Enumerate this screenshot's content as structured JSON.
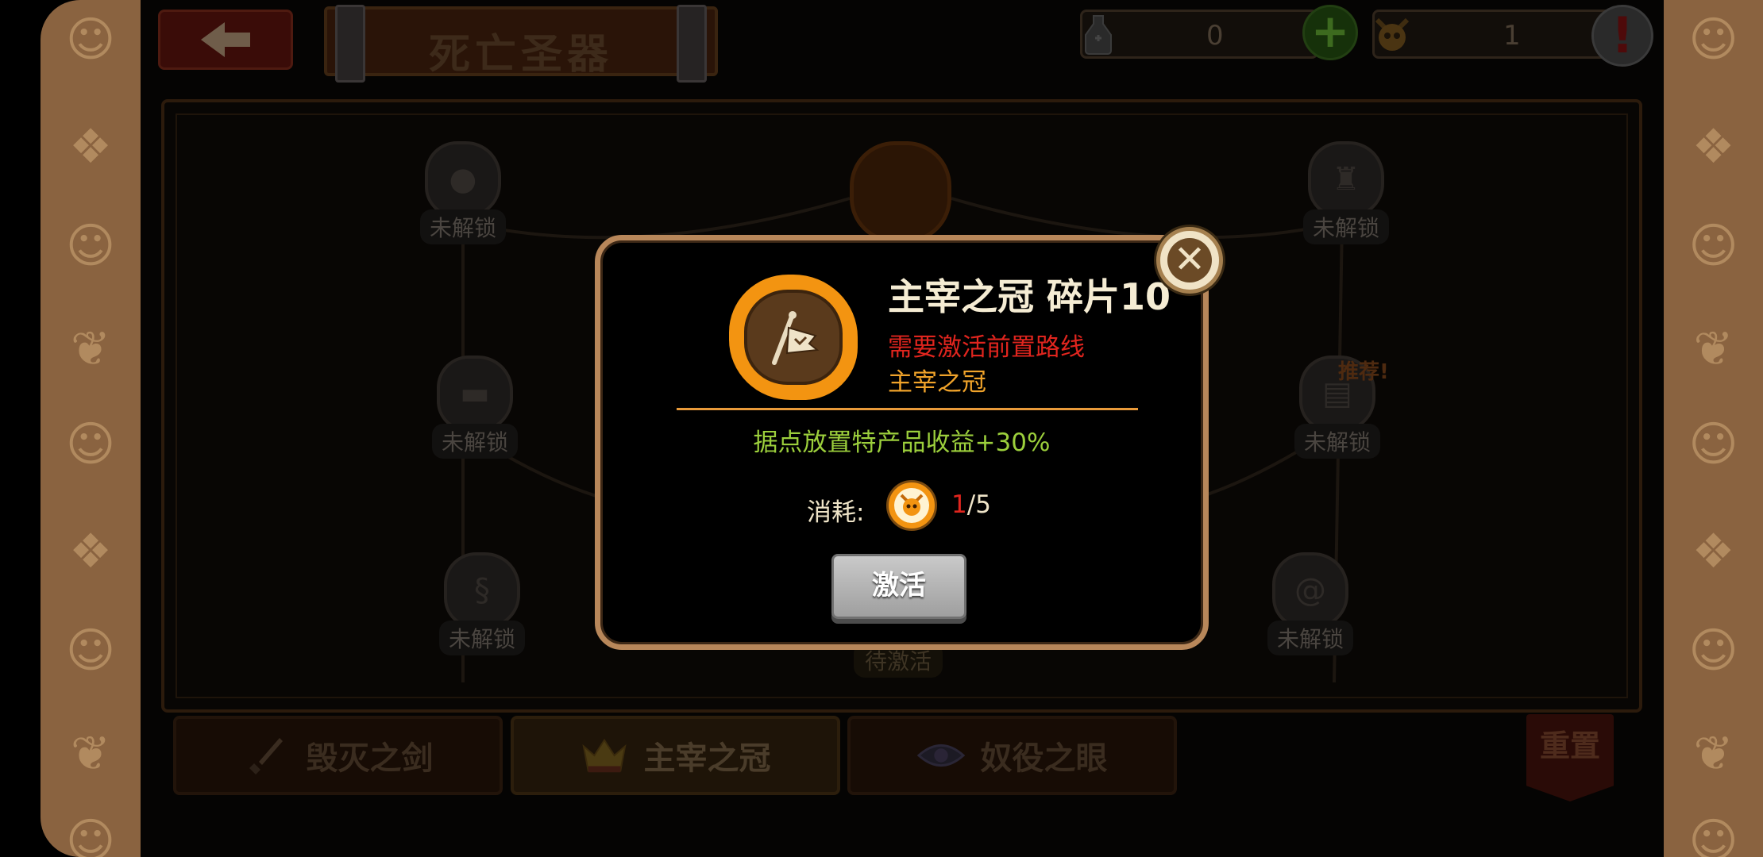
{
  "header": {
    "title": "死亡圣器",
    "back_icon": "back-arrow-icon",
    "resources": [
      {
        "icon": "potion-flask-icon",
        "value": "0"
      },
      {
        "icon": "demon-skull-icon",
        "value": "1"
      }
    ],
    "add_icon": "plus-icon",
    "alert_icon": "exclamation-icon"
  },
  "board": {
    "nodes": [
      {
        "label": "未解锁",
        "icon": "egg-icon"
      },
      {
        "label": "未解锁",
        "icon": "castle-icon"
      },
      {
        "label": "未解锁",
        "icon": "anvil-icon"
      },
      {
        "label": "未解锁",
        "icon": "scroll-icon"
      },
      {
        "label": "未解锁",
        "icon": "swirl-icon"
      },
      {
        "label": "未解锁",
        "icon": "spiral-icon"
      }
    ],
    "recommend_tag": "推荐!",
    "pending_label": "待激活"
  },
  "tabs": [
    {
      "label": "毁灭之剑",
      "icon": "sword-icon",
      "active": false
    },
    {
      "label": "主宰之冠",
      "icon": "crown-icon",
      "active": true
    },
    {
      "label": "奴役之眼",
      "icon": "eye-icon",
      "active": false
    }
  ],
  "reset_label": "重置",
  "modal": {
    "title": "主宰之冠 碎片10",
    "item_icon": "war-banner-icon",
    "requirement": "需要激活前置路线",
    "prerequisite": "主宰之冠",
    "effect": "据点放置特产品收益+30%",
    "cost_label": "消耗:",
    "cost_icon": "demon-skull-icon",
    "cost_have": "1",
    "cost_separator": "/",
    "cost_need": "5",
    "activate_label": "激活",
    "close_icon": "close-x-icon"
  },
  "colors": {
    "accent_orange": "#f39411",
    "frame_tan": "#b8875a",
    "warning_red": "#e0251e",
    "effect_green": "#9ccf3c",
    "side_brown": "#8a6340"
  }
}
